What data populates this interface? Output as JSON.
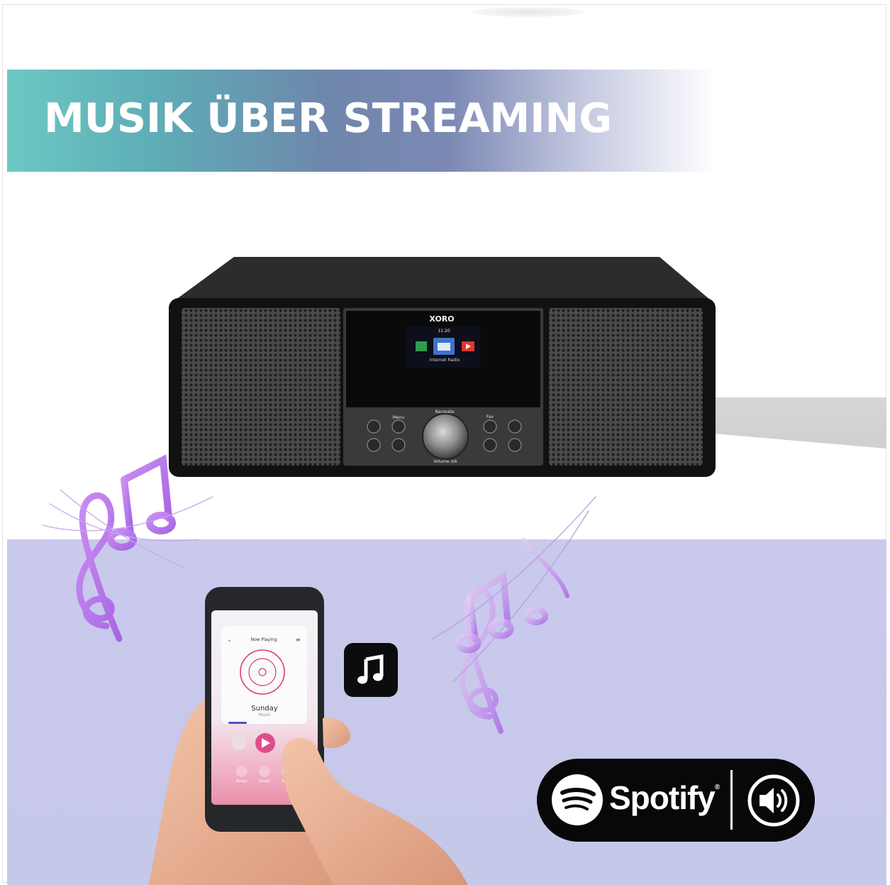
{
  "banner": {
    "title": "MUSIK ÜBER STREAMING"
  },
  "radio": {
    "brand": "XORO",
    "screen_time": "11:20",
    "screen_label": "Internet Radio",
    "button_labels": {
      "menu": "Menu",
      "navigate": "Navigate",
      "fav": "Fav",
      "volume": "Volume /ok"
    }
  },
  "phone": {
    "header": "Now Playing",
    "track_title": "Sunday",
    "track_subtitle": "Music",
    "tabs": [
      "Song1",
      "Song2",
      "Song3"
    ]
  },
  "spotify_badge": {
    "wordmark": "Spotify",
    "registered": "®"
  },
  "icons": [
    "music-note-icon",
    "spotify-logo-icon",
    "speaker-icon",
    "treble-clef-icon"
  ],
  "colors": {
    "banner_start": "#6dc8c3",
    "banner_mid": "#7b88b4",
    "lower_background": "#c8c9ec",
    "note_purple": "#b57bea",
    "badge": "#080808"
  }
}
